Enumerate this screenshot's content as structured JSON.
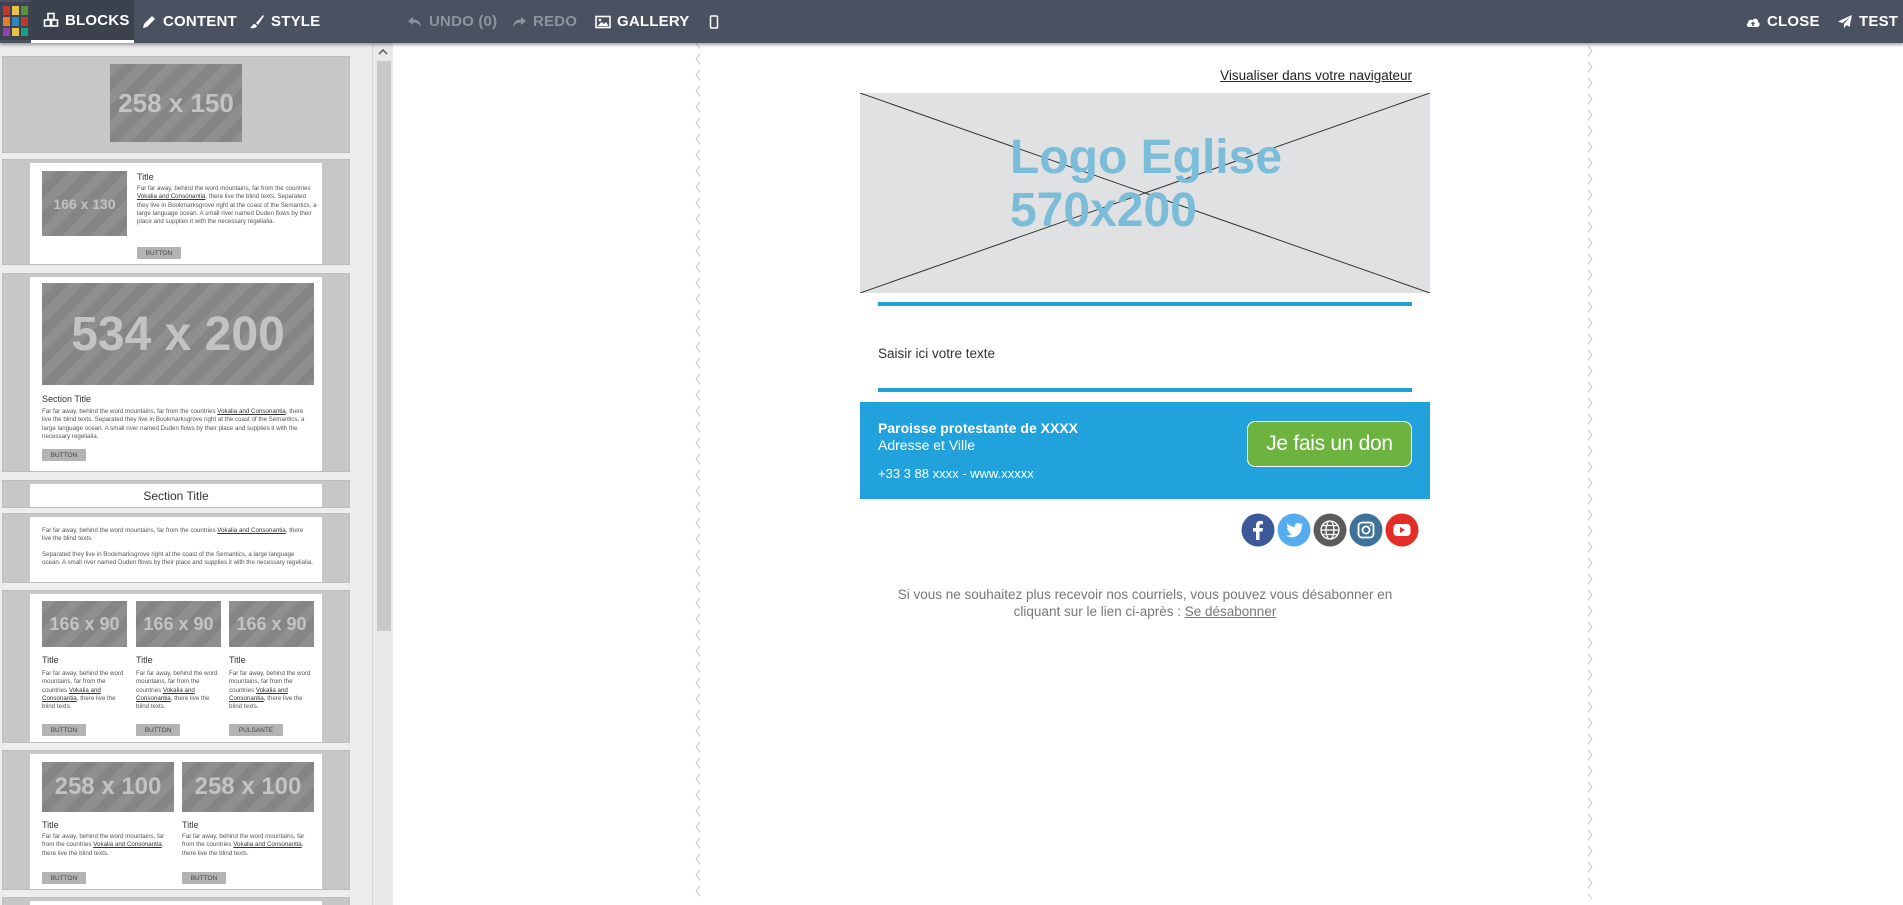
{
  "toolbar": {
    "blocks": "BLOCKS",
    "content": "CONTENT",
    "style": "STYLE",
    "undo": "UNDO (0)",
    "redo": "REDO",
    "gallery": "GALLERY",
    "close": "CLOSE",
    "test": "TEST"
  },
  "sidebar": {
    "block1": {
      "img": "258 x 150"
    },
    "block2": {
      "img": "166 x 130",
      "title": "Title",
      "button": "BUTTON"
    },
    "block3": {
      "img": "534 x 200",
      "title": "Section Title",
      "button": "BUTTON"
    },
    "block4": {
      "title": "Section Title"
    },
    "block6": {
      "cols": [
        {
          "img": "166 x 90",
          "title": "Title",
          "button": "BUTTON"
        },
        {
          "img": "166 x 90",
          "title": "Title",
          "button": "BUTTON"
        },
        {
          "img": "166 x 90",
          "title": "Title",
          "button": "PULSANTE"
        }
      ]
    },
    "block7": {
      "cols": [
        {
          "img": "258 x 100",
          "title": "Title",
          "button": "BUTTON"
        },
        {
          "img": "258 x 100",
          "title": "Title",
          "button": "BUTTON"
        }
      ]
    },
    "lorem": {
      "far": "Far far away, behind the word mountains, far from the countries ",
      "link": "Vokalia and Consonantia",
      "blind": ", there live the blind texts.",
      "sep": "Separated they live in Bookmarksgrove right at the coast of the Semantics, a large language ocean. A small river named Duden flows by their place and supplies it with the necessary regelialia.",
      "col1": "Far far away, behind the word mountains, far from the countries ",
      "col2": ", there live the blind texts."
    }
  },
  "email": {
    "view_in_browser": "Visualiser dans votre navigateur",
    "logo_line1": "Logo Eglise",
    "logo_line2": "570x200",
    "body_text": "Saisir ici votre texte",
    "parish_name": "Paroisse protestante de XXXX",
    "address": "Adresse et Ville",
    "contact": "+33 3 88 xxxx - www.xxxxx",
    "donate_button": "Je fais un don",
    "unsubscribe_text": "Si vous ne souhaitez plus recevoir nos courriels, vous pouvez vous désabonner en cliquant sur le lien ci-après : ",
    "unsubscribe_link": "Se désabonner"
  },
  "colors": {
    "toolbar": "#4a5160",
    "accent": "#1fa0d6",
    "footer": "#22a2dc",
    "donate": "#6db33f",
    "logo_text": "#7bbcd9"
  },
  "icons": [
    "blocks-icon",
    "pencil-icon",
    "brush-icon",
    "undo-icon",
    "redo-icon",
    "image-icon",
    "mobile-icon",
    "cloud-upload-icon",
    "paper-plane-icon",
    "facebook-icon",
    "twitter-icon",
    "globe-icon",
    "instagram-icon",
    "youtube-icon"
  ]
}
